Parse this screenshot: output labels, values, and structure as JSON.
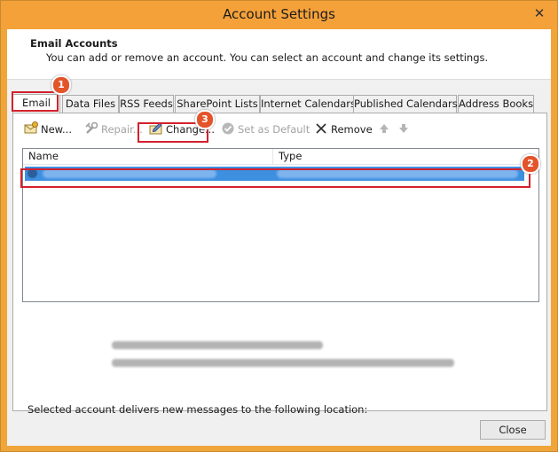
{
  "window": {
    "title": "Account Settings",
    "close_glyph": "✕"
  },
  "header": {
    "title": "Email Accounts",
    "description": "You can add or remove an account. You can select an account and change its settings."
  },
  "tabs": [
    {
      "label": "Email",
      "active": true
    },
    {
      "label": "Data Files"
    },
    {
      "label": "RSS Feeds"
    },
    {
      "label": "SharePoint Lists"
    },
    {
      "label": "Internet Calendars"
    },
    {
      "label": "Published Calendars"
    },
    {
      "label": "Address Books"
    }
  ],
  "toolbar": {
    "new": "New...",
    "repair": "Repair...",
    "change": "Change...",
    "set_default": "Set as Default",
    "remove": "Remove"
  },
  "list": {
    "columns": [
      "Name",
      "Type"
    ]
  },
  "footer": {
    "delivery_label": "Selected account delivers new messages to the following location:",
    "close": "Close"
  },
  "annotations": {
    "badge1": "1",
    "badge2": "2",
    "badge3": "3",
    "color": "#d4202c"
  }
}
